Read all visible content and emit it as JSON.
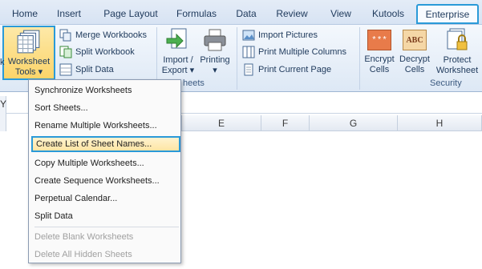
{
  "tabs": [
    {
      "label": "Home"
    },
    {
      "label": "Insert"
    },
    {
      "label": "Page Layout"
    },
    {
      "label": "Formulas"
    },
    {
      "label": "Data"
    },
    {
      "label": "Review"
    },
    {
      "label": "View"
    },
    {
      "label": "Kutools"
    },
    {
      "label": "Enterprise"
    }
  ],
  "ribbon": {
    "worksheet_tools": {
      "line1": "Worksheet",
      "line2": "Tools",
      "arrow": "▾"
    },
    "workbook_group": {
      "merge": "Merge Workbooks",
      "split_wb": "Split Workbook",
      "split_data": "Split Data",
      "left_cut": "k"
    },
    "import_export": {
      "line1": "Import /",
      "line2": "Export",
      "arrow": "▾"
    },
    "printing": {
      "line1": "Printing",
      "arrow": "▾"
    },
    "print_group": {
      "import_pictures": "Import Pictures",
      "print_multi": "Print Multiple Columns",
      "print_current": "Print Current Page"
    },
    "group_label_sheets": "heets",
    "security": {
      "encrypt": {
        "line1": "Encrypt",
        "line2": "Cells",
        "glyph": "***"
      },
      "decrypt": {
        "line1": "Decrypt",
        "line2": "Cells",
        "glyph": "ABC"
      },
      "protect": {
        "line1": "Protect",
        "line2": "Worksheet"
      },
      "group_label": "Security"
    }
  },
  "sheet": {
    "cut_text": "Y",
    "columns": [
      "E",
      "F",
      "G",
      "H"
    ]
  },
  "menu": {
    "items": [
      {
        "label": "Synchronize Worksheets"
      },
      {
        "label": "Sort Sheets..."
      },
      {
        "label": "Rename Multiple Worksheets..."
      },
      {
        "label": "Create List of Sheet Names..."
      },
      {
        "label": "Copy Multiple Worksheets..."
      },
      {
        "label": "Create Sequence Worksheets..."
      },
      {
        "label": "Perpetual Calendar..."
      },
      {
        "label": "Split Data"
      },
      {
        "label": "Delete Blank Worksheets"
      },
      {
        "label": "Delete All Hidden Sheets"
      }
    ]
  },
  "colors": {
    "highlight_border": "#2a9ad8",
    "ribbon_bg": "#dde8f5",
    "menu_highlight": "#fde5a4"
  }
}
